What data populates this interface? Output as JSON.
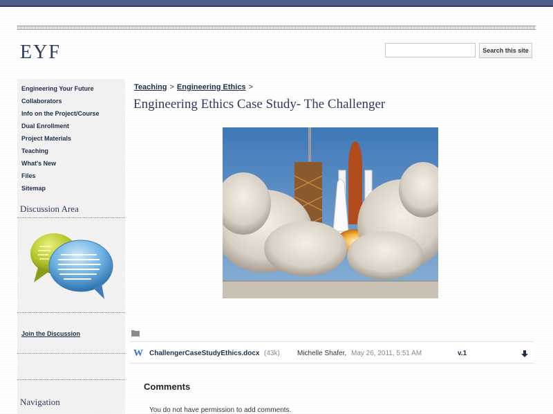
{
  "site": {
    "title": "EYF"
  },
  "search": {
    "placeholder": "",
    "button_label": "Search this site"
  },
  "sidebar": {
    "items": [
      {
        "label": "Engineering Your Future"
      },
      {
        "label": "Collaborators"
      },
      {
        "label": "Info on the Project/Course"
      },
      {
        "label": "Dual Enrollment"
      },
      {
        "label": "Project Materials"
      },
      {
        "label": "Teaching"
      },
      {
        "label": "What's New"
      },
      {
        "label": "Files"
      },
      {
        "label": "Sitemap"
      }
    ],
    "discussion_heading": "Discussion Area",
    "join_link": "Join the Discussion",
    "navigation_heading": "Navigation"
  },
  "breadcrumb": {
    "items": [
      {
        "label": "Teaching"
      },
      {
        "label": "Engineering Ethics"
      }
    ],
    "separator": ">"
  },
  "page": {
    "title": "Engineering Ethics Case Study- The Challenger"
  },
  "attachment": {
    "icon": "W",
    "filename": "ChallengerCaseStudyEthics.docx",
    "size": "(43k)",
    "author": "Michelle Shafer,",
    "date": "May 26, 2011, 5:51 AM",
    "version": "v.1"
  },
  "comments": {
    "heading": "Comments",
    "note": "You do not have permission to add comments."
  },
  "colors": {
    "topbar": "#4e5f8a",
    "link": "#1f2d4a",
    "heading": "#2b3a5e",
    "word_blue": "#3b6fd0"
  }
}
